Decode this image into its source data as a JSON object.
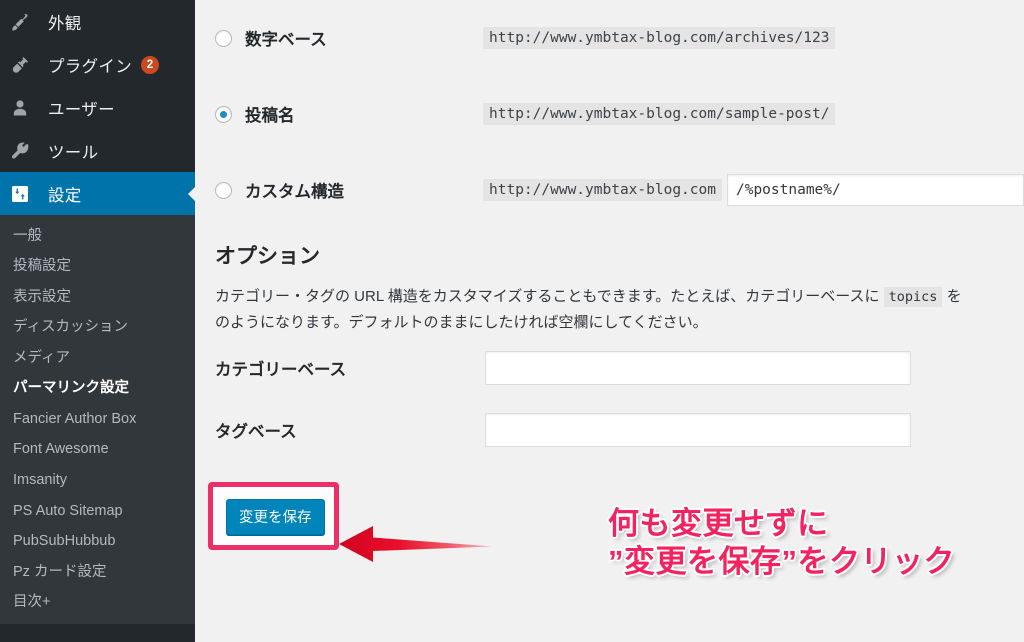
{
  "sidebar": {
    "top_items": [
      {
        "label": "外観",
        "icon": "paintbrush-icon",
        "badge": null,
        "active": false
      },
      {
        "label": "プラグイン",
        "icon": "plug-icon",
        "badge": "2",
        "active": false
      },
      {
        "label": "ユーザー",
        "icon": "user-icon",
        "badge": null,
        "active": false
      },
      {
        "label": "ツール",
        "icon": "wrench-icon",
        "badge": null,
        "active": false
      },
      {
        "label": "設定",
        "icon": "sliders-icon",
        "badge": null,
        "active": true
      }
    ],
    "submenu": [
      {
        "label": "一般",
        "current": false
      },
      {
        "label": "投稿設定",
        "current": false
      },
      {
        "label": "表示設定",
        "current": false
      },
      {
        "label": "ディスカッション",
        "current": false
      },
      {
        "label": "メディア",
        "current": false
      },
      {
        "label": "パーマリンク設定",
        "current": true
      },
      {
        "label": "Fancier Author Box",
        "current": false
      },
      {
        "label": "Font Awesome",
        "current": false
      },
      {
        "label": "Imsanity",
        "current": false
      },
      {
        "label": "PS Auto Sitemap",
        "current": false
      },
      {
        "label": "PubSubHubbub",
        "current": false
      },
      {
        "label": "Pz カード設定",
        "current": false
      },
      {
        "label": "目次+",
        "current": false
      }
    ]
  },
  "permalink": {
    "rows": [
      {
        "label": "数字ベース",
        "url": "http://www.ymbtax-blog.com/archives/123",
        "selected": false,
        "has_input": false
      },
      {
        "label": "投稿名",
        "url": "http://www.ymbtax-blog.com/sample-post/",
        "selected": true,
        "has_input": false
      },
      {
        "label": "カスタム構造",
        "url": "http://www.ymbtax-blog.com",
        "selected": false,
        "has_input": true,
        "input_value": "/%postname%/"
      }
    ]
  },
  "options": {
    "title": "オプション",
    "desc_part1": "カテゴリー・タグの URL 構造をカスタマイズすることもできます。たとえば、カテゴリーベースに ",
    "desc_code": "topics",
    "desc_part2": " を",
    "desc_line2": "のようになります。デフォルトのままにしたければ空欄にしてください。",
    "fields": [
      {
        "label": "カテゴリーベース",
        "value": "",
        "placeholder": ""
      },
      {
        "label": "タグベース",
        "value": "",
        "placeholder": ""
      }
    ]
  },
  "save": {
    "button_label": "変更を保存"
  },
  "annotation": {
    "line1": "何も変更せずに",
    "line2": "”変更を保存”をクリック",
    "text_color": "#f4225f",
    "box_color": "#ec2f67",
    "arrow_color": "#e8112d"
  }
}
